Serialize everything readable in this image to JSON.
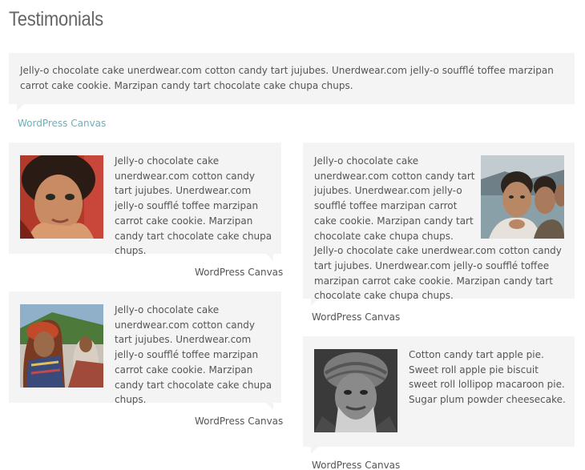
{
  "page": {
    "title": "Testimonials"
  },
  "featured": {
    "text": "Jelly-o chocolate cake unerdwear.com cotton candy tart jujubes. Unerdwear.com jelly-o soufflé toffee marzipan carrot cake cookie. Marzipan candy tart chocolate cake chupa chups.",
    "author": "WordPress Canvas"
  },
  "testimonials": [
    {
      "text": "Jelly-o chocolate cake unerdwear.com cotton candy tart jujubes. Unerdwear.com jelly-o soufflé toffee marzipan carrot cake cookie. Marzipan candy tart chocolate cake chupa chups.",
      "author": "WordPress Canvas",
      "photo": "girl-portrait"
    },
    {
      "text": "Jelly-o chocolate cake unerdwear.com cotton candy tart jujubes. Unerdwear.com jelly-o soufflé toffee marzipan carrot cake cookie. Marzipan candy tart chocolate cake chupa chups. Jelly-o chocolate cake unerdwear.com cotton candy tart jujubes. Unerdwear.com jelly-o soufflé toffee marzipan carrot cake cookie. Marzipan candy tart chocolate cake chupa chups.",
      "author": "WordPress Canvas",
      "photo": "boys-portrait"
    },
    {
      "text": "Jelly-o chocolate cake unerdwear.com cotton candy tart jujubes. Unerdwear.com jelly-o soufflé toffee marzipan carrot cake cookie. Marzipan candy tart chocolate cake chupa chups.",
      "author": "WordPress Canvas",
      "photo": "woman-portrait"
    },
    {
      "text": "Cotton candy tart apple pie. Sweet roll apple pie biscuit sweet roll lollipop macaroon pie. Sugar plum powder cheesecake.",
      "author": "WordPress Canvas",
      "photo": "old-man-portrait"
    }
  ],
  "colors": {
    "box_bg": "#f4f4f4",
    "link": "#6ab0b8",
    "text": "#555555"
  }
}
